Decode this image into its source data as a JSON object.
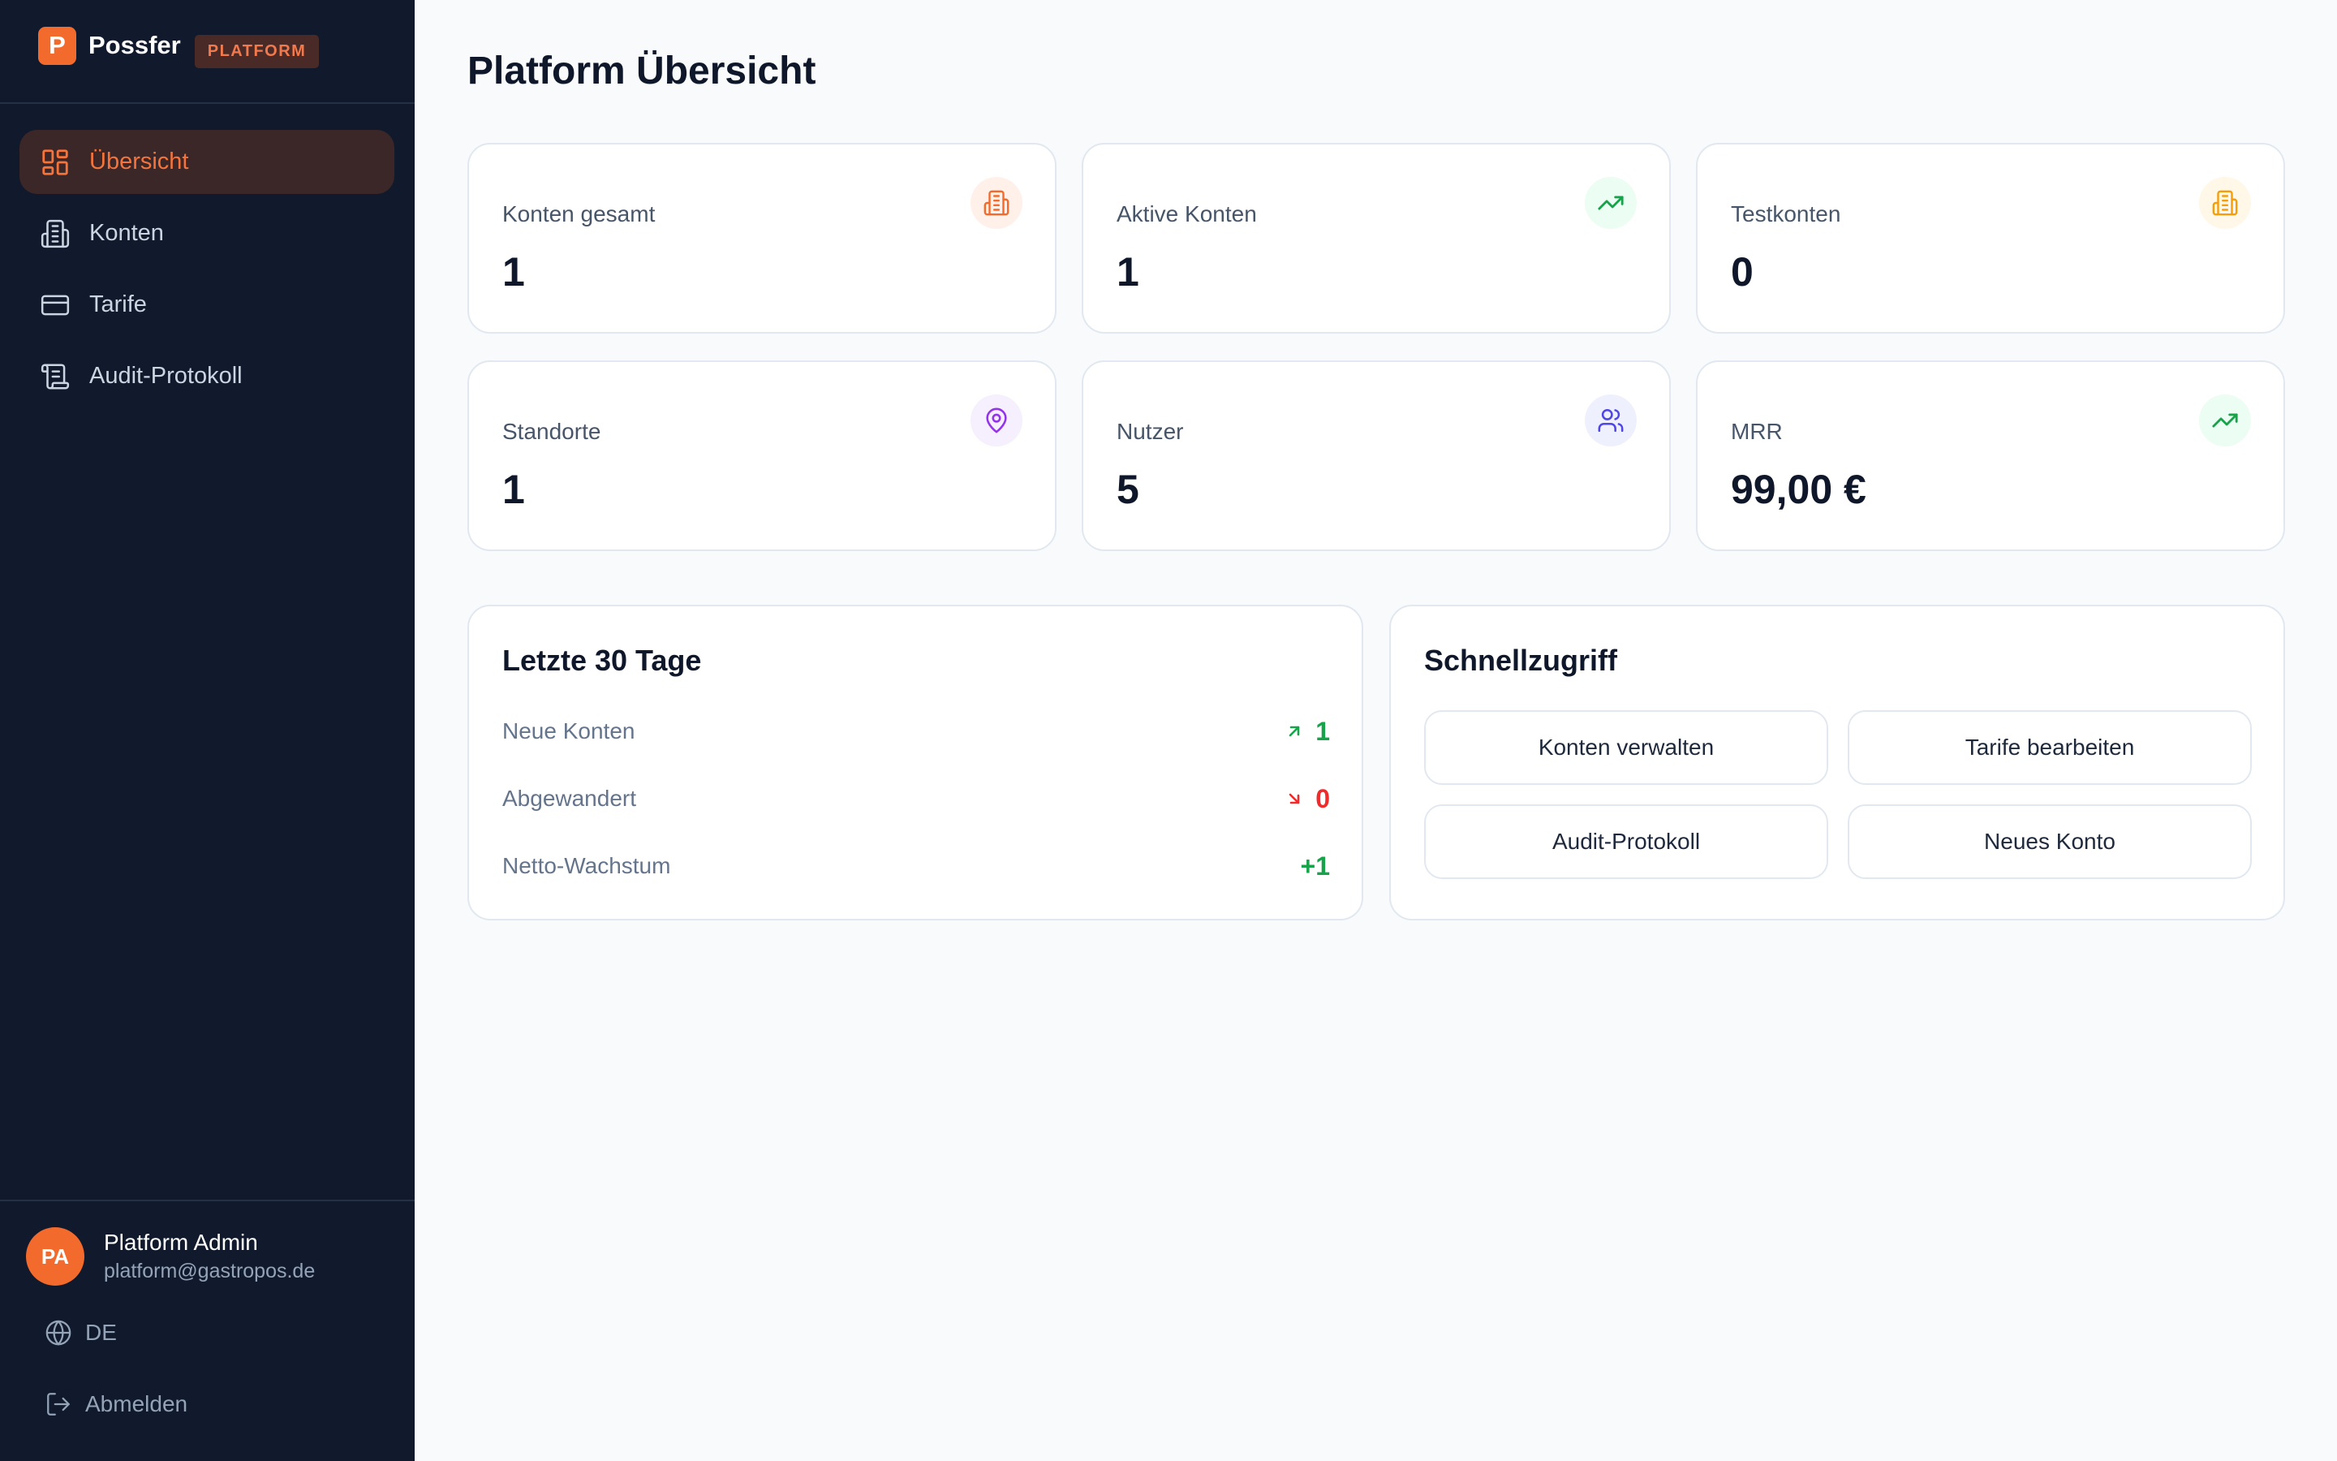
{
  "brand": {
    "logo_letter": "P",
    "name": "Possfer",
    "badge": "PLATFORM"
  },
  "nav": [
    {
      "label": "Übersicht",
      "icon": "dashboard-icon",
      "active": true
    },
    {
      "label": "Konten",
      "icon": "building-icon",
      "active": false
    },
    {
      "label": "Tarife",
      "icon": "credit-card-icon",
      "active": false
    },
    {
      "label": "Audit-Protokoll",
      "icon": "scroll-icon",
      "active": false
    }
  ],
  "user": {
    "initials": "PA",
    "name": "Platform Admin",
    "email": "platform@gastropos.de"
  },
  "footer": {
    "language": "DE",
    "logout": "Abmelden"
  },
  "page": {
    "title": "Platform Übersicht"
  },
  "stats": [
    {
      "label": "Konten gesamt",
      "value": "1",
      "icon": "building-icon",
      "color": "#f26b2c"
    },
    {
      "label": "Aktive Konten",
      "value": "1",
      "icon": "trending-up-icon",
      "color": "#16a34a"
    },
    {
      "label": "Testkonten",
      "value": "0",
      "icon": "building-icon",
      "color": "#f59e0b"
    },
    {
      "label": "Standorte",
      "value": "1",
      "icon": "map-pin-icon",
      "color": "#9333ea"
    },
    {
      "label": "Nutzer",
      "value": "5",
      "icon": "users-icon",
      "color": "#4f46e5"
    },
    {
      "label": "MRR",
      "value": "99,00 €",
      "icon": "trending-up-icon",
      "color": "#16a34a"
    }
  ],
  "last30": {
    "title": "Letzte 30 Tage",
    "rows": [
      {
        "label": "Neue Konten",
        "value": "1",
        "icon": "arrow-up-right-icon",
        "color": "#16a34a"
      },
      {
        "label": "Abgewandert",
        "value": "0",
        "icon": "arrow-down-right-icon",
        "color": "#ef2b2b"
      },
      {
        "label": "Netto-Wachstum",
        "value": "+1",
        "color": "#16a34a"
      }
    ]
  },
  "quick": {
    "title": "Schnellzugriff",
    "buttons": [
      "Konten verwalten",
      "Tarife bearbeiten",
      "Audit-Protokoll",
      "Neues Konto"
    ]
  }
}
